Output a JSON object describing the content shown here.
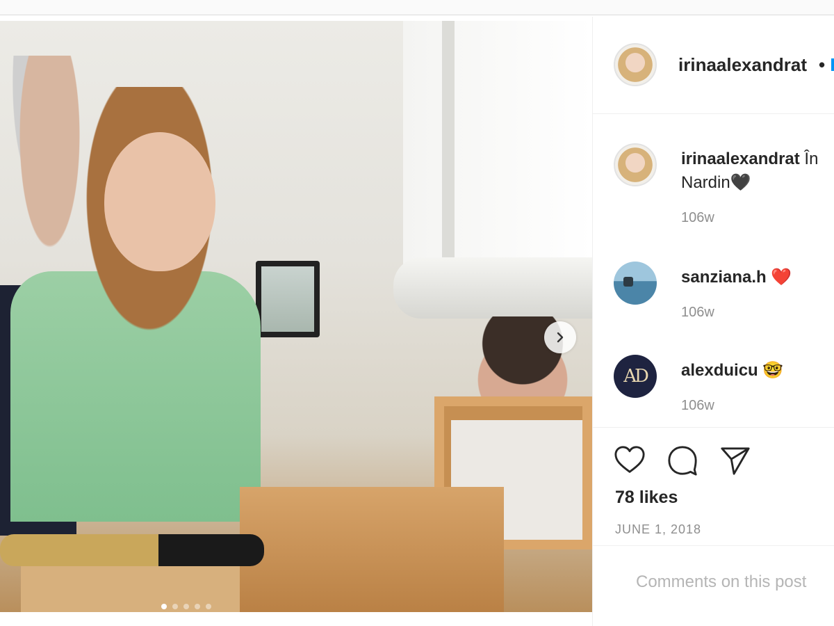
{
  "post": {
    "author": "irinaalexandrat",
    "separator": "•",
    "carousel_dots": 5,
    "active_dot": 0
  },
  "comments": [
    {
      "username": "irinaalexandrat",
      "text_line1": "În",
      "text_line2": "Nardin🖤",
      "time": "106w",
      "avatar": "profile-photo"
    },
    {
      "username": "sanziana.h",
      "text_line1": "❤️",
      "time": "106w",
      "avatar": "sea-photo"
    },
    {
      "username": "alexduicu",
      "text_line1": "🤓",
      "time": "106w",
      "avatar": "AD-monogram",
      "avatar_text": "AD"
    }
  ],
  "actions": {
    "like_icon": "heart-icon",
    "comment_icon": "comment-bubble-icon",
    "share_icon": "paper-plane-icon",
    "likes": "78 likes",
    "date": "JUNE 1, 2018"
  },
  "comment_input": {
    "placeholder": "Comments on this post"
  },
  "colors": {
    "text": "#262626",
    "muted": "#8e8e8e",
    "border": "#efefef",
    "accent": "#0095f6"
  }
}
